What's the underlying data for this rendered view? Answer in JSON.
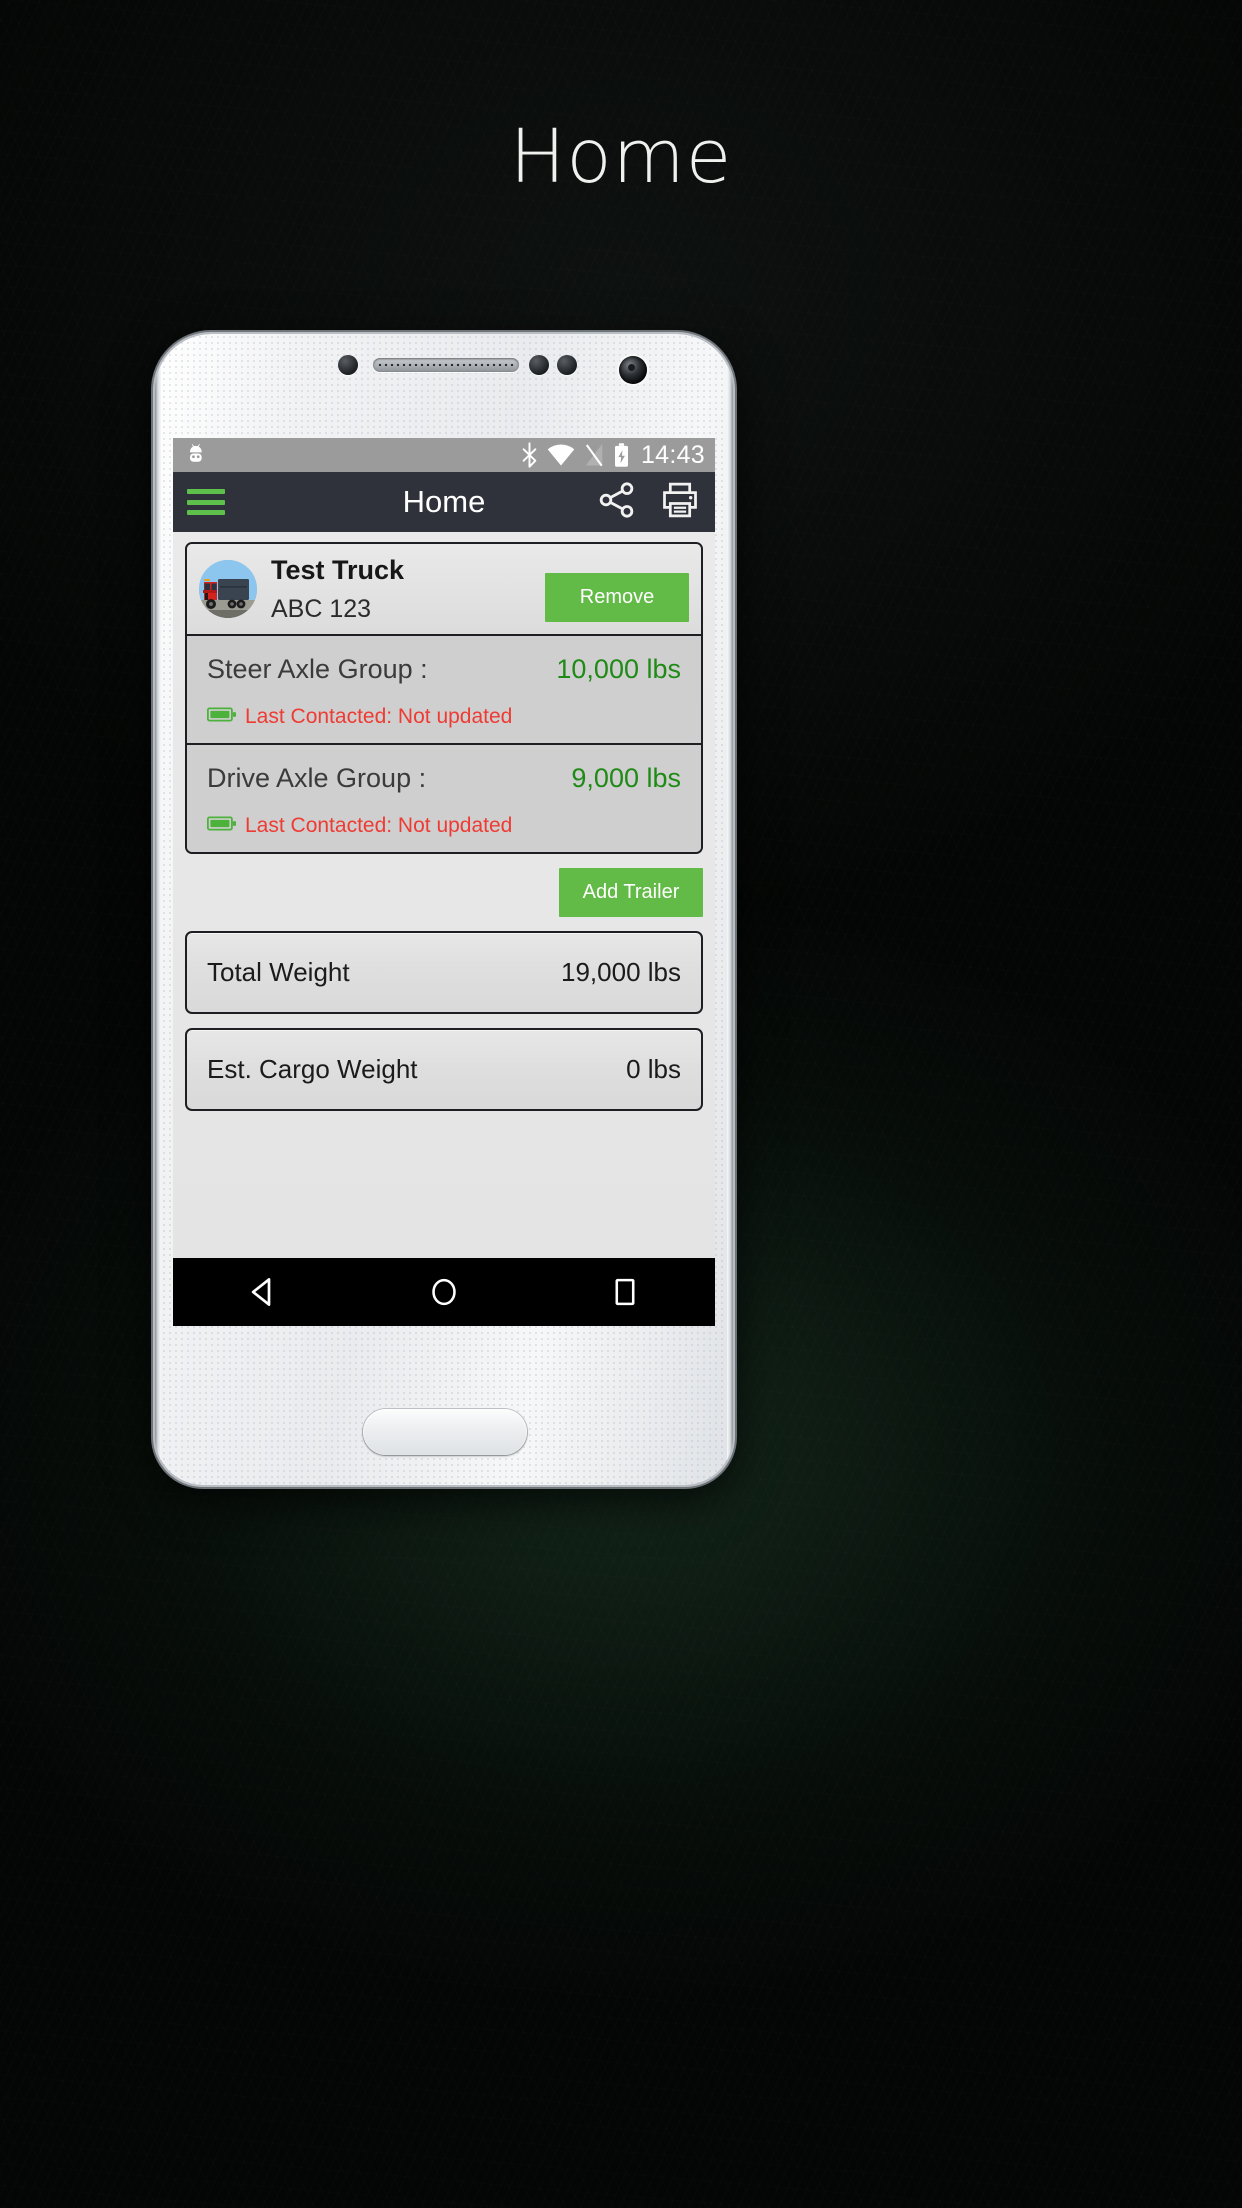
{
  "page": {
    "heading": "Home"
  },
  "phone": {
    "status_bar": {
      "notification_icon": "android-icon",
      "clock": "14:43",
      "icons": [
        "bluetooth-icon",
        "wifi-icon",
        "signal-off-icon",
        "battery-charging-icon"
      ]
    },
    "app_bar": {
      "menu_icon": "hamburger-menu-icon",
      "title": "Home",
      "actions": [
        {
          "name": "share-icon",
          "label": "Share"
        },
        {
          "name": "print-icon",
          "label": "Print"
        }
      ]
    },
    "nav_bar": {
      "back": "back-triangle-icon",
      "home": "home-circle-icon",
      "recents": "recents-square-icon"
    }
  },
  "truck": {
    "avatar_icon": "truck-photo",
    "name": "Test Truck",
    "plate": "ABC 123",
    "remove_label": "Remove"
  },
  "axle_groups": [
    {
      "label": "Steer Axle Group :",
      "weight": "10,000 lbs",
      "battery_icon": "battery-full-icon",
      "status": "Last Contacted: Not updated"
    },
    {
      "label": "Drive Axle Group :",
      "weight": "9,000 lbs",
      "battery_icon": "battery-full-icon",
      "status": "Last Contacted: Not updated"
    }
  ],
  "actions": {
    "add_trailer_label": "Add Trailer"
  },
  "summary": [
    {
      "label": "Total Weight",
      "value": "19,000 lbs"
    },
    {
      "label": "Est. Cargo Weight",
      "value": "0 lbs"
    }
  ],
  "colors": {
    "accent_green": "#62bb46",
    "weight_green": "#1f8b16",
    "status_red": "#ee3b33",
    "app_bar": "#2f323a",
    "status_bar": "#9b9b9b"
  }
}
